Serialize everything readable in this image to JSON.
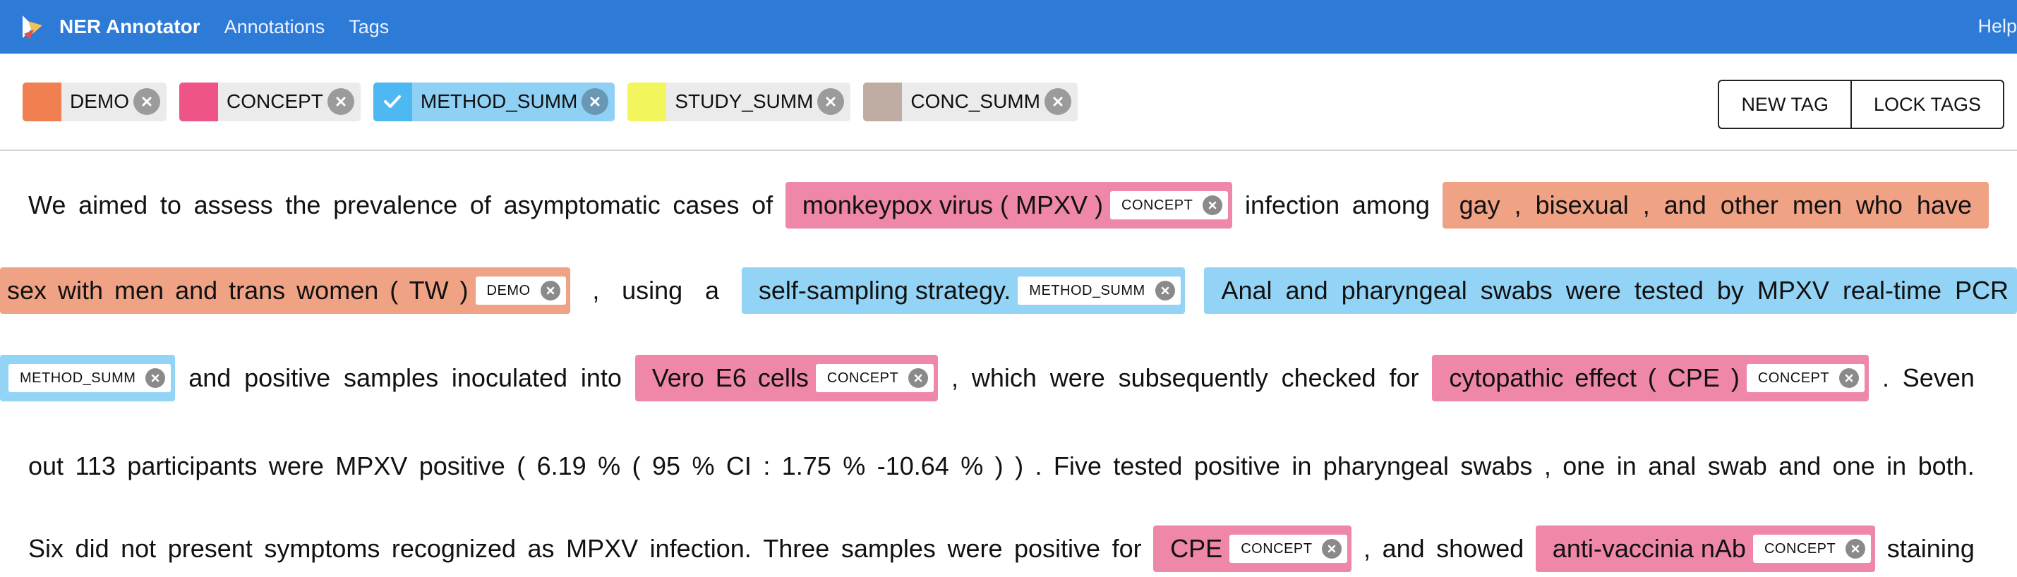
{
  "navbar": {
    "brand": "NER Annotator",
    "links": [
      "Annotations",
      "Tags"
    ],
    "help": "Help"
  },
  "tags": [
    {
      "label": "DEMO",
      "color": "#f07f52",
      "active": false
    },
    {
      "label": "CONCEPT",
      "color": "#ee5586",
      "active": false
    },
    {
      "label": "METHOD_SUMM",
      "color": "#4db8f1",
      "active": true
    },
    {
      "label": "STUDY_SUMM",
      "color": "#f2f65c",
      "active": false
    },
    {
      "label": "CONC_SUMM",
      "color": "#bfada4",
      "active": false
    }
  ],
  "buttons": {
    "new_tag": "NEW TAG",
    "lock_tags": "LOCK TAGS"
  },
  "text": {
    "line1": {
      "words": [
        "We",
        "aimed",
        "to",
        "assess",
        "the",
        "prevalence",
        "of",
        "asymptomatic",
        "cases",
        "of"
      ],
      "ent1": {
        "text": "monkeypox virus ( MPXV )",
        "tag": "CONCEPT"
      },
      "mid": [
        "infection",
        "among"
      ],
      "ent2": {
        "text": "gay , bisexual , and other men who have"
      }
    },
    "line2": {
      "ent1": {
        "text": "sex with men and trans women ( TW )",
        "tag": "DEMO"
      },
      "words": [
        ",",
        "using",
        "a"
      ],
      "ent2": {
        "text": "self-sampling strategy.",
        "tag": "METHOD_SUMM"
      },
      "ent3": {
        "text": "Anal and pharyngeal swabs were tested by MPXV real-time PCR"
      }
    },
    "line3": {
      "ent1": {
        "tag": "METHOD_SUMM"
      },
      "words1": [
        "and",
        "positive",
        "samples",
        "inoculated",
        "into"
      ],
      "ent2": {
        "text": "Vero E6 cells",
        "tag": "CONCEPT"
      },
      "words2": [
        ",",
        "which",
        "were",
        "subsequently",
        "checked",
        "for"
      ],
      "ent3": {
        "text": "cytopathic effect ( CPE )",
        "tag": "CONCEPT"
      },
      "words3": [
        ".",
        "Seven"
      ]
    },
    "line4": {
      "words": [
        "out",
        "113",
        "participants",
        "were",
        "MPXV",
        "positive",
        "(",
        "6.19",
        "%",
        "(",
        "95",
        "%",
        "CI",
        ":",
        "1.75",
        "%",
        "-10.64",
        "%",
        ")",
        ")",
        ".",
        "Five",
        "tested",
        "positive",
        "in",
        "pharyngeal",
        "swabs",
        ",",
        "one",
        "in",
        "anal",
        "swab",
        "and",
        "one",
        "in",
        "both."
      ]
    },
    "line5": {
      "words1": [
        "Six",
        "did",
        "not",
        "present",
        "symptoms",
        "recognized",
        "as",
        "MPXV",
        "infection.",
        "Three",
        "samples",
        "were",
        "positive",
        "for"
      ],
      "ent1": {
        "text": "CPE",
        "tag": "CONCEPT"
      },
      "words2": [
        ",",
        "and",
        "showed"
      ],
      "ent2": {
        "text": "anti-vaccinia nAb",
        "tag": "CONCEPT"
      },
      "words3": [
        "staining"
      ]
    }
  }
}
